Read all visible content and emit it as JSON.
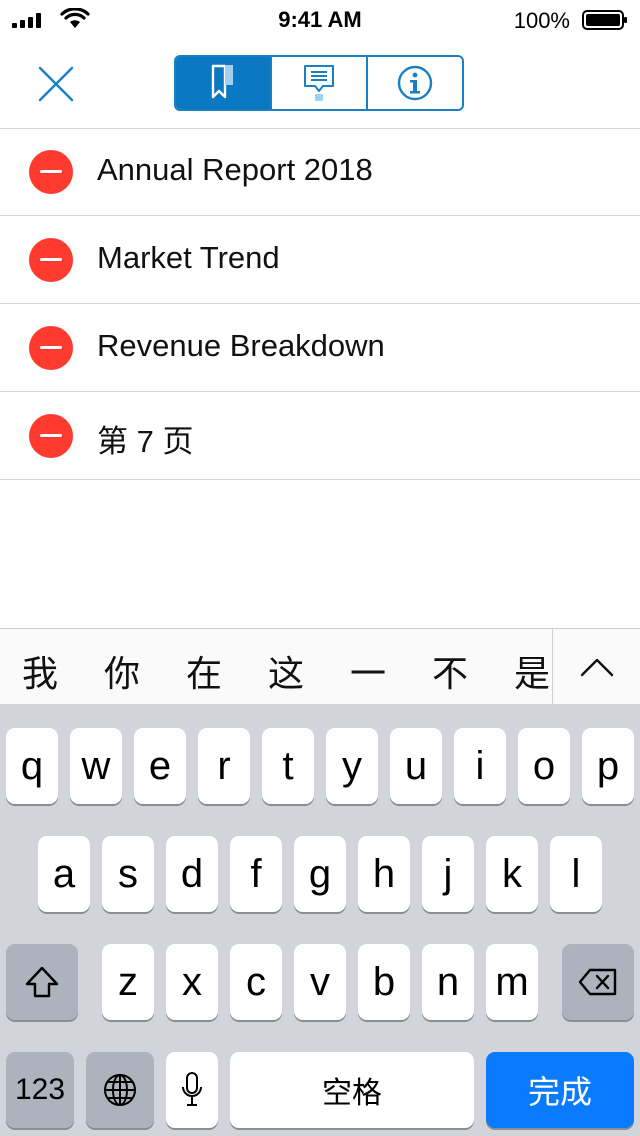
{
  "status_bar": {
    "time": "9:41 AM",
    "battery": "100%"
  },
  "header": {
    "segments": [
      {
        "name": "bookmark-icon",
        "active": true
      },
      {
        "name": "comment-icon",
        "active": false
      },
      {
        "name": "info-icon",
        "active": false
      }
    ]
  },
  "list": {
    "items": [
      {
        "label": "Annual Report 2018"
      },
      {
        "label": "Market Trend"
      },
      {
        "label": "Revenue Breakdown"
      },
      {
        "label": "第 7 页"
      }
    ]
  },
  "candidates": [
    "我",
    "你",
    "在",
    "这",
    "一",
    "不",
    "是"
  ],
  "keyboard": {
    "row1": [
      "q",
      "w",
      "e",
      "r",
      "t",
      "y",
      "u",
      "i",
      "o",
      "p"
    ],
    "row2": [
      "a",
      "s",
      "d",
      "f",
      "g",
      "h",
      "j",
      "k",
      "l"
    ],
    "row3": [
      "z",
      "x",
      "c",
      "v",
      "b",
      "n",
      "m"
    ],
    "numbers_label": "123",
    "space_label": "空格",
    "done_label": "完成"
  },
  "colors": {
    "accent": "#0a78c2",
    "delete": "#ff3b30",
    "done_key": "#0a7aff"
  }
}
